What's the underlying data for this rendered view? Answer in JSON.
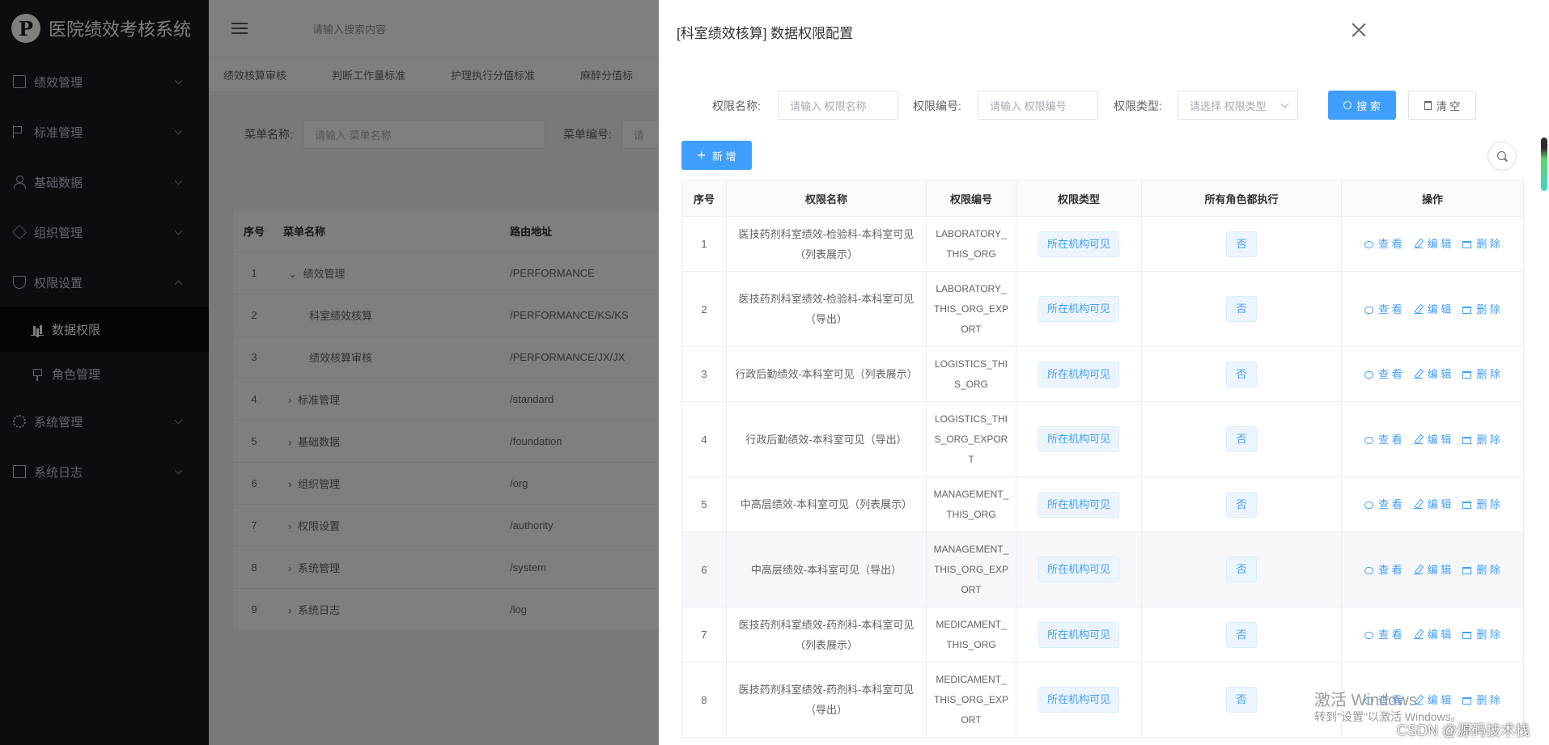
{
  "app": {
    "title": "医院绩效考核系统",
    "logo_letter": "P"
  },
  "sidebar": {
    "items": [
      {
        "label": "绩效管理",
        "icon": "document-icon"
      },
      {
        "label": "标准管理",
        "icon": "flag-icon"
      },
      {
        "label": "基础数据",
        "icon": "user-icon"
      },
      {
        "label": "组织管理",
        "icon": "tag-icon"
      },
      {
        "label": "权限设置",
        "icon": "shield-icon"
      },
      {
        "label": "系统管理",
        "icon": "gear-icon"
      },
      {
        "label": "系统日志",
        "icon": "log-icon"
      }
    ],
    "sub": [
      {
        "label": "数据权限",
        "icon": "bar-chart-icon"
      },
      {
        "label": "角色管理",
        "icon": "pin-icon"
      }
    ]
  },
  "topbar": {
    "search_placeholder": "请输入搜索内容"
  },
  "tabs": [
    "绩效核算审核",
    "判断工作量标准",
    "护理执行分值标准",
    "麻醉分值标"
  ],
  "bg_filter": {
    "menu_name_label": "菜单名称:",
    "menu_name_placeholder": "请输入 菜单名称",
    "menu_code_label": "菜单编号:",
    "menu_code_placeholder": "请"
  },
  "bg_table": {
    "headers": [
      "序号",
      "菜单名称",
      "路由地址"
    ],
    "rows": [
      {
        "no": "1",
        "name": "绩效管理",
        "path": "/PERFORMANCE"
      },
      {
        "no": "2",
        "name": "科室绩效核算",
        "path": "/PERFORMANCE/KS/KS"
      },
      {
        "no": "3",
        "name": "绩效核算审核",
        "path": "/PERFORMANCE/JX/JX"
      },
      {
        "no": "4",
        "name": "标准管理",
        "path": "/standard"
      },
      {
        "no": "5",
        "name": "基础数据",
        "path": "/foundation"
      },
      {
        "no": "6",
        "name": "组织管理",
        "path": "/org"
      },
      {
        "no": "7",
        "name": "权限设置",
        "path": "/authority"
      },
      {
        "no": "8",
        "name": "系统管理",
        "path": "/system"
      },
      {
        "no": "9",
        "name": "系统日志",
        "path": "/log"
      }
    ]
  },
  "drawer": {
    "title": "[科室绩效核算] 数据权限配置",
    "search": {
      "name_label": "权限名称:",
      "name_placeholder": "请输入 权限名称",
      "code_label": "权限编号:",
      "code_placeholder": "请输入 权限编号",
      "type_label": "权限类型:",
      "type_placeholder": "请选择 权限类型",
      "search_btn": "搜 索",
      "clear_btn": "清 空"
    },
    "add_btn": "新 增",
    "headers": [
      "序号",
      "权限名称",
      "权限编号",
      "权限类型",
      "所有角色都执行",
      "操作"
    ],
    "ops": {
      "view": "查 看",
      "edit": "编 辑",
      "delete": "删 除"
    },
    "rows": [
      {
        "no": "1",
        "name": "医技药剂科室绩效-检验科-本科室可见（列表展示）",
        "code": "LABORATORY_THIS_ORG",
        "type": "所在机构可见",
        "all": "否"
      },
      {
        "no": "2",
        "name": "医技药剂科室绩效-检验科-本科室可见（导出）",
        "code": "LABORATORY_THIS_ORG_EXPORT",
        "type": "所在机构可见",
        "all": "否"
      },
      {
        "no": "3",
        "name": "行政后勤绩效-本科室可见（列表展示）",
        "code": "LOGISTICS_THIS_ORG",
        "type": "所在机构可见",
        "all": "否"
      },
      {
        "no": "4",
        "name": "行政后勤绩效-本科室可见（导出）",
        "code": "LOGISTICS_THIS_ORG_EXPORT",
        "type": "所在机构可见",
        "all": "否"
      },
      {
        "no": "5",
        "name": "中高层绩效-本科室可见（列表展示）",
        "code": "MANAGEMENT_THIS_ORG",
        "type": "所在机构可见",
        "all": "否"
      },
      {
        "no": "6",
        "name": "中高层绩效-本科室可见（导出）",
        "code": "MANAGEMENT_THIS_ORG_EXPORT",
        "type": "所在机构可见",
        "all": "否"
      },
      {
        "no": "7",
        "name": "医技药剂科室绩效-药剂科-本科室可见（列表展示）",
        "code": "MEDICAMENT_THIS_ORG",
        "type": "所在机构可见",
        "all": "否"
      },
      {
        "no": "8",
        "name": "医技药剂科室绩效-药剂科-本科室可见（导出）",
        "code": "MEDICAMENT_THIS_ORG_EXPORT",
        "type": "所在机构可见",
        "all": "否"
      }
    ]
  },
  "watermark": {
    "line1": "激活 Windows",
    "line2": "转到\"设置\"以激活 Windows。",
    "csdn": "CSDN @源码技术栈"
  },
  "colors": {
    "primary": "#409eff",
    "sidebar": "#191a23"
  }
}
